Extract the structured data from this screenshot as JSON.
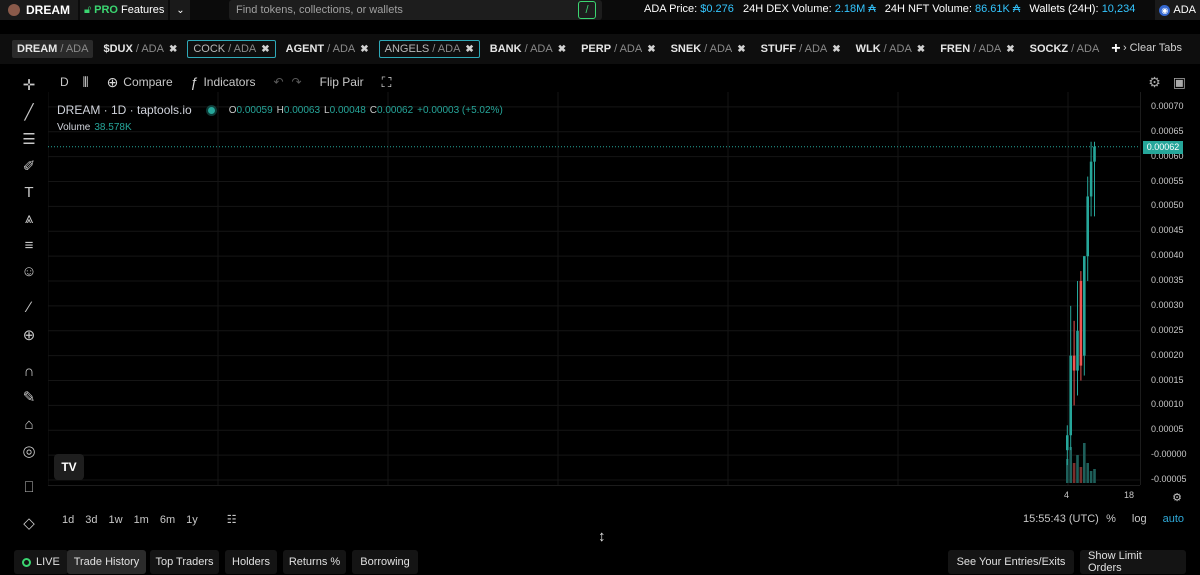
{
  "topbar": {
    "brand": "DREAM",
    "pro_label": "PRO",
    "pro_features": "Features",
    "search_placeholder": "Find tokens, collections, or wallets",
    "search_key": "/",
    "stats": {
      "ada_price_label": "ADA Price:",
      "ada_price": "$0.276",
      "dex_label": "24H DEX Volume:",
      "dex_value": "2.18M ₳",
      "nft_label": "24H NFT Volume:",
      "nft_value": "86.61K ₳",
      "wallets_label": "Wallets (24H):",
      "wallets_value": "10,234"
    },
    "currency": "ADA"
  },
  "tabs": [
    {
      "sym": "DREAM",
      "quote": "/ ADA",
      "style": "active",
      "close": false
    },
    {
      "sym": "$DUX",
      "quote": "/ ADA",
      "style": "plain",
      "close": true
    },
    {
      "sym": "COCK",
      "quote": "/ ADA",
      "style": "boxed",
      "close": true
    },
    {
      "sym": "AGENT",
      "quote": "/ ADA",
      "style": "plain",
      "close": true
    },
    {
      "sym": "ANGELS",
      "quote": "/ ADA",
      "style": "boxed",
      "close": true
    },
    {
      "sym": "BANK",
      "quote": "/ ADA",
      "style": "plain",
      "close": true
    },
    {
      "sym": "PERP",
      "quote": "/ ADA",
      "style": "plain",
      "close": true
    },
    {
      "sym": "SNEK",
      "quote": "/ ADA",
      "style": "plain",
      "close": true
    },
    {
      "sym": "STUFF",
      "quote": "/ ADA",
      "style": "plain",
      "close": true
    },
    {
      "sym": "WLK",
      "quote": "/ ADA",
      "style": "plain",
      "close": true
    },
    {
      "sym": "FREN",
      "quote": "/ ADA",
      "style": "plain",
      "close": true
    },
    {
      "sym": "SOCKZ",
      "quote": "/ ADA",
      "style": "plain",
      "close": false
    }
  ],
  "clear_tabs": "Clear Tabs",
  "toolbar": {
    "interval": "D",
    "compare": "Compare",
    "indicators": "Indicators",
    "flip_pair": "Flip Pair"
  },
  "legend": {
    "title": "DREAM · 1D · taptools.io",
    "o_key": "O",
    "o": "0.00059",
    "h_key": "H",
    "h": "0.00063",
    "l_key": "L",
    "l": "0.00048",
    "c_key": "C",
    "c": "0.00062",
    "change": "+0.00003 (+5.02%)",
    "volume_label": "Volume",
    "volume_value": "38.578K"
  },
  "price_scale": {
    "ticks": [
      "0.00070",
      "0.00065",
      "0.00060",
      "0.00055",
      "0.00050",
      "0.00045",
      "0.00040",
      "0.00035",
      "0.00030",
      "0.00025",
      "0.00020",
      "0.00015",
      "0.00010",
      "0.00005",
      "-0.00000",
      "-0.00005"
    ],
    "current": "0.00062"
  },
  "time_scale": {
    "ticks": [
      "4",
      "18"
    ]
  },
  "range_buttons": [
    "1d",
    "3d",
    "1w",
    "1m",
    "6m",
    "1y"
  ],
  "clock": "15:55:43 (UTC)",
  "scale_options": [
    "%",
    "log",
    "auto"
  ],
  "bottom": {
    "live": "LIVE",
    "tabs": [
      "Trade History",
      "Top Traders",
      "Holders",
      "Returns %",
      "Borrowing"
    ],
    "entries": "See Your Entries/Exits",
    "limit": "Show Limit Orders"
  },
  "chart_data": {
    "type": "candlestick",
    "ylim": [
      -6e-05,
      0.00073
    ],
    "up_color": "#26a69a",
    "down_color": "#ef5350",
    "candles": [
      {
        "o": 1e-05,
        "h": 6e-05,
        "l": -2e-05,
        "c": 4e-05,
        "up": true
      },
      {
        "o": 4e-05,
        "h": 0.0003,
        "l": 1e-05,
        "c": 0.0002,
        "up": true
      },
      {
        "o": 0.0002,
        "h": 0.00027,
        "l": 0.0001,
        "c": 0.00017,
        "up": false
      },
      {
        "o": 0.00017,
        "h": 0.00035,
        "l": 0.00012,
        "c": 0.00025,
        "up": true
      },
      {
        "o": 0.00018,
        "h": 0.00037,
        "l": 0.00015,
        "c": 0.00035,
        "up": false
      },
      {
        "o": 0.0002,
        "h": 0.0004,
        "l": 0.00016,
        "c": 0.0004,
        "up": true
      },
      {
        "o": 0.0004,
        "h": 0.00056,
        "l": 0.00035,
        "c": 0.00052,
        "up": true
      },
      {
        "o": 0.00052,
        "h": 0.00063,
        "l": 0.00048,
        "c": 0.00059,
        "up": true
      },
      {
        "o": 0.00059,
        "h": 0.00063,
        "l": 0.00048,
        "c": 0.00062,
        "up": true
      }
    ],
    "volume": [
      0.6,
      0.9,
      0.5,
      0.7,
      0.4,
      1.0,
      0.5,
      0.3,
      0.35
    ]
  }
}
